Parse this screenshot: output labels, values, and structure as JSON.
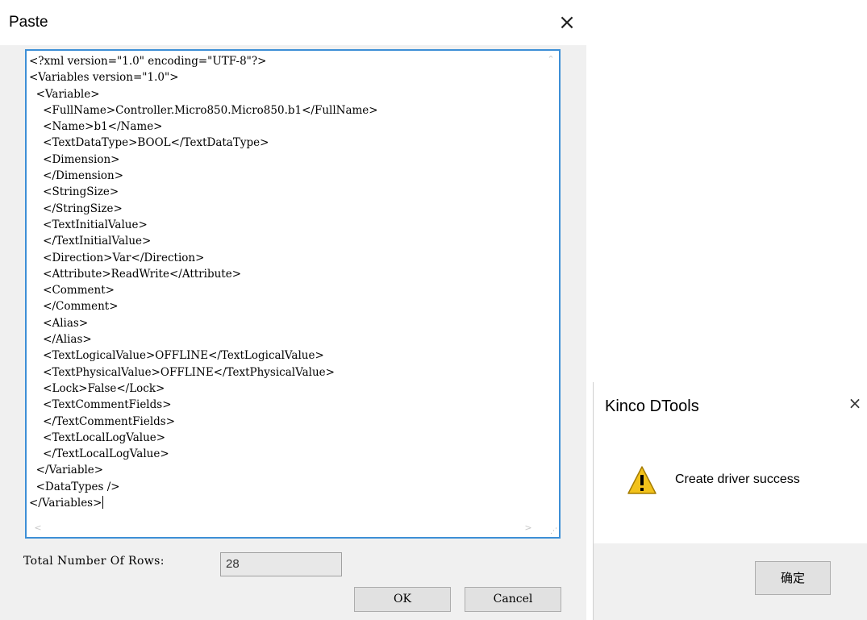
{
  "paste_dialog": {
    "title": "Paste",
    "close_glyph": "×",
    "xml_lines": [
      "<?xml version=\"1.0\" encoding=\"UTF-8\"?>",
      "<Variables version=\"1.0\">",
      "  <Variable>",
      "    <FullName>Controller.Micro850.Micro850.b1</FullName>",
      "    <Name>b1</Name>",
      "    <TextDataType>BOOL</TextDataType>",
      "    <Dimension>",
      "    </Dimension>",
      "    <StringSize>",
      "    </StringSize>",
      "    <TextInitialValue>",
      "    </TextInitialValue>",
      "    <Direction>Var</Direction>",
      "    <Attribute>ReadWrite</Attribute>",
      "    <Comment>",
      "    </Comment>",
      "    <Alias>",
      "    </Alias>",
      "    <TextLogicalValue>OFFLINE</TextLogicalValue>",
      "    <TextPhysicalValue>OFFLINE</TextPhysicalValue>",
      "    <Lock>False</Lock>",
      "    <TextCommentFields>",
      "    </TextCommentFields>",
      "    <TextLocalLogValue>",
      "    </TextLocalLogValue>",
      "  </Variable>",
      "  <DataTypes />",
      "</Variables>"
    ],
    "scroll_up_glyph": "⌃",
    "scroll_left_glyph": "<",
    "scroll_right_glyph": ">",
    "rows_label": "Total Number Of Rows:",
    "rows_value": "28",
    "ok_label": "OK",
    "cancel_label": "Cancel"
  },
  "message_box": {
    "title": "Kinco DTools",
    "close_glyph": "×",
    "message": "Create driver success",
    "ok_label": "确定",
    "icon": "warning-icon"
  }
}
